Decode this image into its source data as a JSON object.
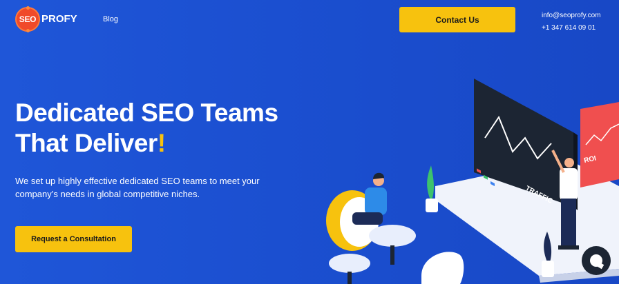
{
  "header": {
    "logo_badge": "SEO",
    "logo_word": "PROFY",
    "nav_blog": "Blog",
    "contact_button": "Contact Us",
    "email": "info@seoprofy.com",
    "phone": "+1 347 614 09 01"
  },
  "hero": {
    "title_line1": "Dedicated SEO Teams",
    "title_line2": "That Deliver",
    "title_exclamation": "!",
    "subtitle_line1": "We set up highly effective dedicated SEO teams to meet your",
    "subtitle_line2": "company’s needs in global competitive niches.",
    "cta_button": "Request a Consultation"
  },
  "illustration": {
    "screen_label": "TRAFFIC",
    "board_label": "ROI"
  },
  "colors": {
    "background": "#1f56d8",
    "accent": "#f7c20e",
    "logo_red": "#f04a2a",
    "board_red": "#f04f4f",
    "chat_dark": "#1c2533"
  },
  "icons": [
    "logo-badge-icon",
    "chat-icon",
    "plant-icon"
  ]
}
